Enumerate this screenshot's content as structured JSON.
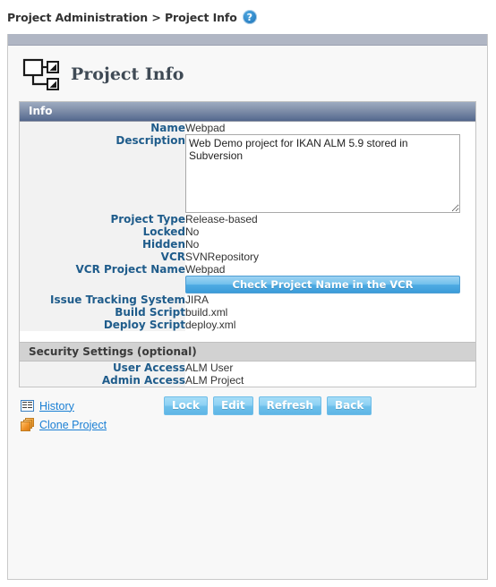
{
  "breadcrumb": {
    "text": "Project Administration > Project Info",
    "help_icon": "help-icon",
    "help_label": "?"
  },
  "page": {
    "title": "Project Info",
    "icon": "project-hierarchy-icon"
  },
  "sections": {
    "info_header": "Info",
    "security_header": "Security Settings (optional)"
  },
  "fields": {
    "name": {
      "label": "Name",
      "value": "Webpad"
    },
    "description": {
      "label": "Description",
      "value": "Web Demo project for IKAN ALM 5.9 stored in Subversion"
    },
    "project_type": {
      "label": "Project Type",
      "value": "Release-based"
    },
    "locked": {
      "label": "Locked",
      "value": "No"
    },
    "hidden": {
      "label": "Hidden",
      "value": "No"
    },
    "vcr": {
      "label": "VCR",
      "value": "SVNRepository"
    },
    "vcr_project_name": {
      "label": "VCR Project Name",
      "value": "Webpad"
    },
    "issue_tracking_system": {
      "label": "Issue Tracking System",
      "value": "JIRA"
    },
    "build_script": {
      "label": "Build Script",
      "value": "build.xml"
    },
    "deploy_script": {
      "label": "Deploy Script",
      "value": "deploy.xml"
    },
    "user_access": {
      "label": "User Access",
      "value": "ALM User"
    },
    "admin_access": {
      "label": "Admin Access",
      "value": "ALM Project"
    }
  },
  "actions": {
    "check_vcr": "Check Project Name in the VCR",
    "history": "History",
    "clone_project": "Clone Project",
    "lock": "Lock",
    "edit": "Edit",
    "refresh": "Refresh",
    "back": "Back"
  },
  "colors": {
    "label_text": "#1f5c8b",
    "section_header_bg": "#5a6e92",
    "button_blue": "#6cbfea",
    "link_blue": "#1a7fd4",
    "panel_top_bar": "#b0b6c4"
  }
}
